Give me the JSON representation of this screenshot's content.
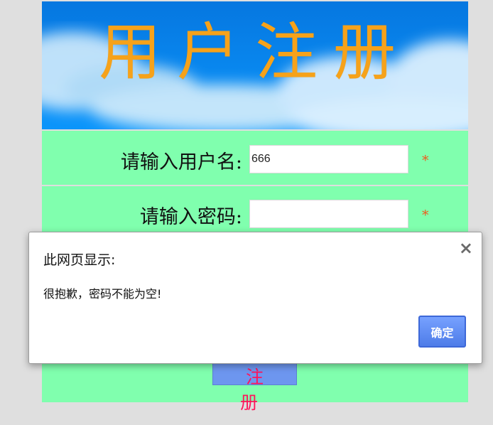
{
  "banner": {
    "title": "用户注册"
  },
  "form": {
    "username_label": "请输入用户名:",
    "username_value": "666",
    "password_label": "请输入密码:",
    "password_value": "",
    "required_mark": "*",
    "submit_label": "注 册"
  },
  "dialog": {
    "title": "此网页显示:",
    "message": "很抱歉，密码不能为空!",
    "close_icon": "×",
    "ok_label": "确定"
  },
  "colors": {
    "background": "#dfdfdf",
    "banner_sky": "#0588f3",
    "banner_title": "#f6a21a",
    "form_background": "#80ffae",
    "required": "#ef5a1d",
    "submit_background": "#6d96ef",
    "submit_text": "#ff145b",
    "dialog_button": "#4e7ce8"
  }
}
